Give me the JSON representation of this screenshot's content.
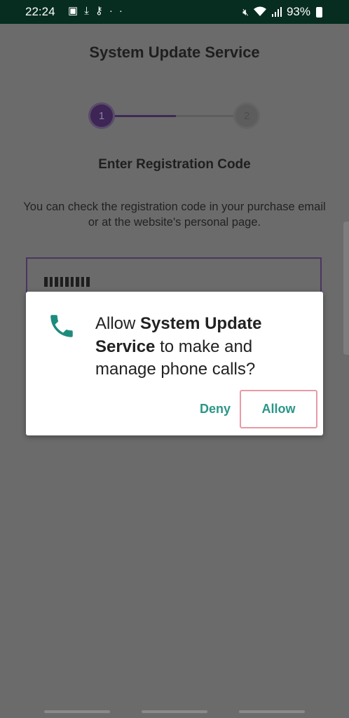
{
  "status_bar": {
    "time": "22:24",
    "left_icons": [
      "image-icon",
      "download-icon",
      "key-icon",
      "more-dots-icon"
    ],
    "battery_percent": "93%",
    "right_icons": [
      "mute-icon",
      "wifi-icon",
      "signal-icon",
      "battery-icon"
    ]
  },
  "app": {
    "title": "System Update Service",
    "steps": [
      "1",
      "2"
    ],
    "current_step": 1,
    "subtitle": "Enter Registration Code",
    "description": "You can check the registration code in your purchase email or at the website's personal page."
  },
  "dialog": {
    "icon": "phone-icon",
    "message_prefix": "Allow ",
    "app_name": "System Update Service",
    "message_suffix": " to make and manage phone calls?",
    "deny_label": "Deny",
    "allow_label": "Allow",
    "accent_color": "#2a9687"
  }
}
